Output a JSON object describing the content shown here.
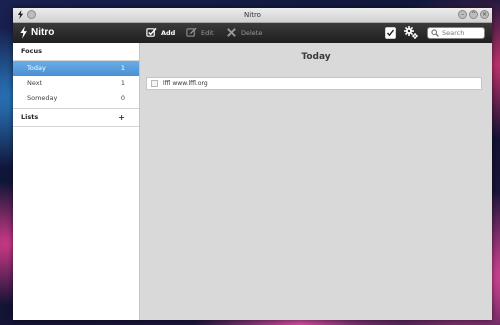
{
  "window": {
    "title": "Nitro"
  },
  "toolbar": {
    "brand": "Nitro",
    "add_label": "Add",
    "edit_label": "Edit",
    "delete_label": "Delete",
    "search_placeholder": "Search"
  },
  "sidebar": {
    "focus_heading": "Focus",
    "items": [
      {
        "label": "Today",
        "count": "1",
        "active": true
      },
      {
        "label": "Next",
        "count": "1",
        "active": false
      },
      {
        "label": "Someday",
        "count": "0",
        "active": false
      }
    ],
    "lists_heading": "Lists",
    "lists_add": "+"
  },
  "main": {
    "title": "Today",
    "tasks": [
      {
        "text": "lffl www.lffl.org",
        "done": false
      }
    ]
  },
  "colors": {
    "accent": "#4a8fd2",
    "toolbar": "#2a2a2a"
  },
  "icons": {
    "brand": "bolt-icon",
    "add": "add-task-icon",
    "edit": "edit-icon",
    "delete": "delete-icon",
    "checklist": "checklist-icon",
    "settings": "gear-icon",
    "search": "search-icon"
  }
}
